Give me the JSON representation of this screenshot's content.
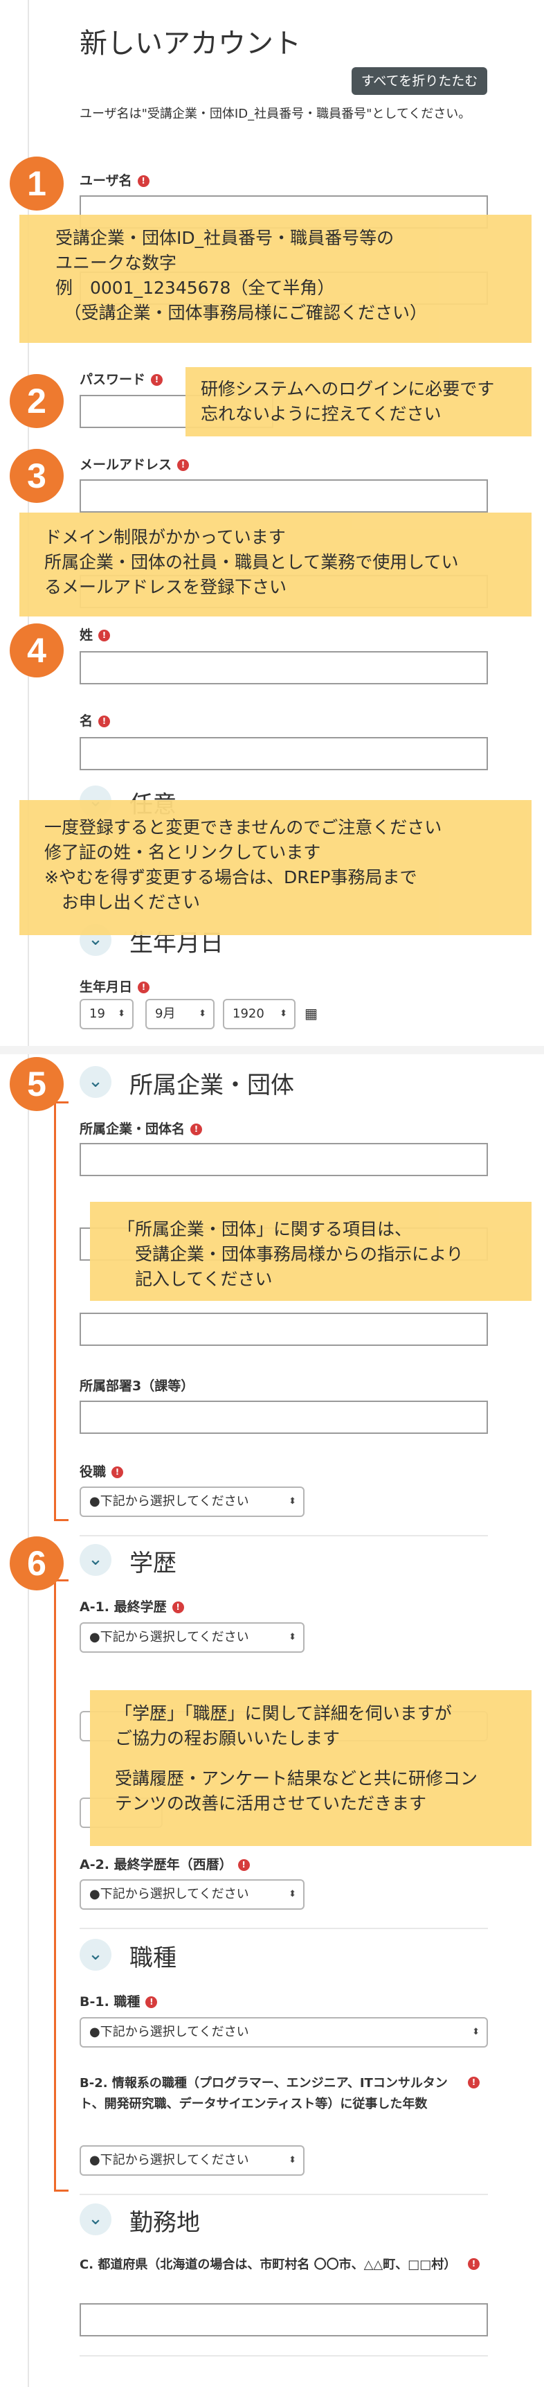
{
  "page": {
    "title": "新しいアカウント",
    "collapse_all": "すべてを折りたたむ",
    "username_note": "ユーザ名は\"受講企業・団体ID_社員番号・職員番号\"としてください。"
  },
  "fields": {
    "username": "ユーザ名",
    "password": "パスワード",
    "email": "メールアドレス",
    "last_name": "姓",
    "first_name": "名",
    "birthdate": "生年月日",
    "birth_day": "19",
    "birth_month": "9月",
    "birth_year": "1920",
    "company": "所属企業・団体名",
    "dept3": "所属部署3（課等）",
    "position": "役職",
    "edu_final": "A-1. 最終学歴",
    "edu_year": "A-2. 最終学歴年（西暦）",
    "job_type": "B-1. 職種",
    "it_years": "B-2. 情報系の職種（プログラマー、エンジニア、ITコンサルタント、開発研究職、データサイエンティスト等）に従事した年数",
    "prefecture": "C. 都道府県（北海道の場合は、市町村名 〇〇市、△△町、□□村）",
    "select_placeholder": "●下記から選択してください"
  },
  "sections": {
    "birthdate": "生年月日",
    "affiliation": "所属企業・団体",
    "education": "学歴",
    "job": "職種",
    "workplace": "勤務地",
    "hidden_partial": "任意"
  },
  "badges": [
    "1",
    "2",
    "3",
    "4",
    "5",
    "6"
  ],
  "callouts": {
    "c1": [
      "受講企業・団体ID_社員番号・職員番号等の",
      "ユニークな数字",
      "例　0001_12345678（全て半角）",
      "　（受講企業・団体事務局様にご確認ください）"
    ],
    "c2": [
      "研修システムへのログインに必要です",
      "忘れないように控えてください"
    ],
    "c3": [
      "ドメイン制限がかかっています",
      "所属企業・団体の社員・職員として業務で使用してい",
      "るメールアドレスを登録下さい"
    ],
    "c4": [
      "一度登録すると変更できませんのでご注意ください",
      "修了証の姓・名とリンクしています",
      "※やむを得ず変更する場合は、DREP事務局まで",
      "　お申し出ください"
    ],
    "c5": [
      "「所属企業・団体」に関する項目は、",
      "　受講企業・団体事務局様からの指示により",
      "　記入してください"
    ],
    "c6": [
      "「学歴」「職歴」に関して詳細を伺いますが",
      "ご協力の程お願いいたします",
      "",
      "受講履歴・アンケート結果などと共に研修コン",
      "テンツの改善に活用させていただきます"
    ]
  },
  "colors": {
    "accent": "#ee7a2f",
    "callout_bg": "#fdd97c",
    "required": "#d63c3c",
    "collapse_btn": "#4b5458"
  },
  "icons": {
    "chevron": "chevron-down-icon",
    "required": "exclamation-icon",
    "calendar": "calendar-icon"
  },
  "glyphs": {
    "chevron": "⌄",
    "required": "!",
    "caret": "⬍",
    "calendar": "▦"
  }
}
